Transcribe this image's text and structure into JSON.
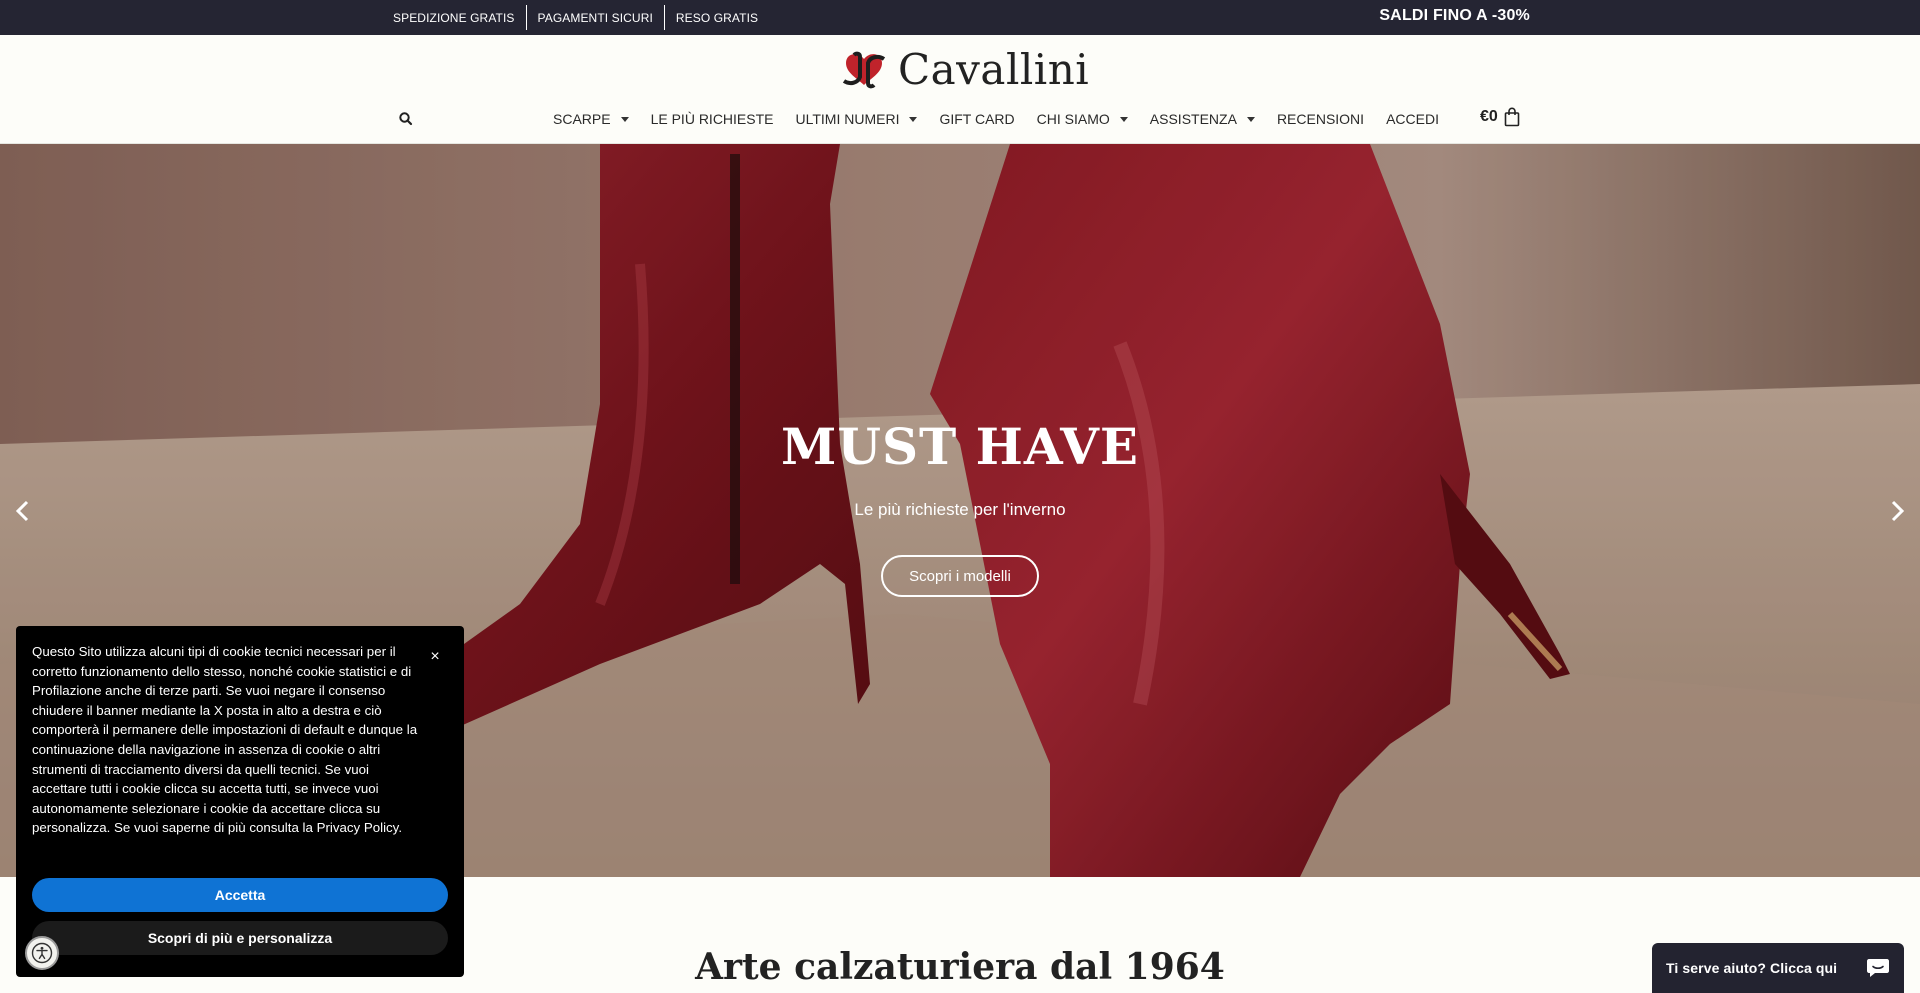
{
  "topbar": {
    "links": [
      "SPEDIZIONE GRATIS",
      "PAGAMENTI SICURI",
      "RESO GRATIS"
    ],
    "promo": "SALDI FINO A -30%"
  },
  "header": {
    "logo_text": "Cavallini",
    "nav": [
      {
        "label": "SCARPE",
        "dropdown": true
      },
      {
        "label": "LE PIÙ RICHIESTE",
        "dropdown": false
      },
      {
        "label": "ULTIMI NUMERI",
        "dropdown": true
      },
      {
        "label": "GIFT CARD",
        "dropdown": false
      },
      {
        "label": "CHI SIAMO",
        "dropdown": true
      },
      {
        "label": "ASSISTENZA",
        "dropdown": true
      },
      {
        "label": "RECENSIONI",
        "dropdown": false
      },
      {
        "label": "ACCEDI",
        "dropdown": false
      }
    ],
    "cart_total": "€0",
    "icons": {
      "search": "search-icon",
      "cart": "shopping-bag-icon",
      "logo": "logo-mark"
    }
  },
  "hero": {
    "title": "MUST HAVE",
    "subtitle": "Le più richieste per l'inverno",
    "cta": "Scopri i modelli"
  },
  "section": {
    "title": "Arte calzaturiera dal 1964"
  },
  "cookie": {
    "text": "Questo Sito utilizza alcuni tipi di cookie tecnici necessari per il corretto funzionamento dello stesso, nonché cookie statistici e di Profilazione anche di terze parti. Se vuoi negare il consenso chiudere il banner mediante la X posta in alto a destra e ciò comporterà il permanere delle impostazioni di default e dunque la continuazione della navigazione in assenza di cookie o altri strumenti di tracciamento diversi da quelli tecnici. Se vuoi accettare tutti i cookie clicca su accetta tutti, se invece vuoi autonomamente selezionare i cookie da accettare clicca su personalizza. Se vuoi saperne di più consulta la Privacy Policy.",
    "close": "×",
    "accept": "Accetta",
    "more": "Scopri di più e personalizza"
  },
  "chat": {
    "label": "Ti serve aiuto? Clicca qui"
  },
  "colors": {
    "topbar": "#252533",
    "accent_blue": "#0f73d4",
    "boot_red": "#8a1a22"
  }
}
